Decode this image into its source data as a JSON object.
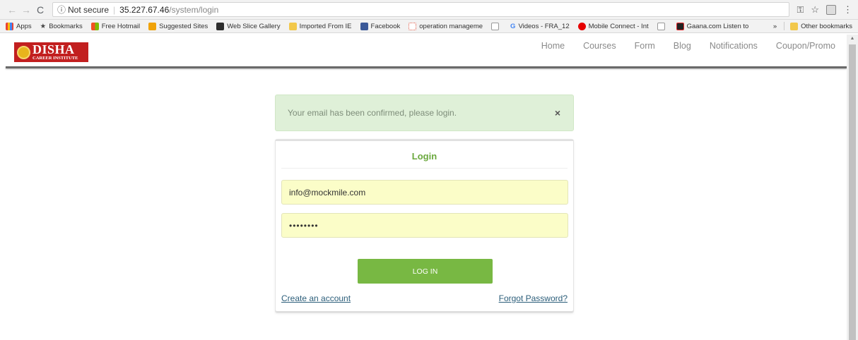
{
  "browser": {
    "security_label": "Not secure",
    "url_host": "35.227.67.46",
    "url_path": "/system/login"
  },
  "bookmarks": {
    "items": [
      {
        "label": "Apps",
        "icon": "apps-grid-icon",
        "color": "#3b78e7"
      },
      {
        "label": "Bookmarks",
        "icon": "star-icon",
        "color": "#444444"
      },
      {
        "label": "Free Hotmail",
        "icon": "windows-icon",
        "color": "#f25022"
      },
      {
        "label": "Suggested Sites",
        "icon": "suggested-sites-icon",
        "color": "#f0a30a"
      },
      {
        "label": "Web Slice Gallery",
        "icon": "web-slice-icon",
        "color": "#2d2d2d"
      },
      {
        "label": "Imported From IE",
        "icon": "folder-icon",
        "color": "#f2c84b"
      },
      {
        "label": "Facebook",
        "icon": "facebook-icon",
        "color": "#3b5998"
      },
      {
        "label": "operation manageme",
        "icon": "operation-icon",
        "color": "#e05a47"
      },
      {
        "label": "",
        "icon": "page-icon",
        "color": "#999999"
      },
      {
        "label": "Videos - FRA_12",
        "icon": "google-icon",
        "color": "#4285f4"
      },
      {
        "label": "Mobile Connect - Int",
        "icon": "vodafone-icon",
        "color": "#e60000"
      },
      {
        "label": "",
        "icon": "page-icon",
        "color": "#999999"
      },
      {
        "label": "Gaana.com Listen to",
        "icon": "gaana-icon",
        "color": "#e72c30"
      }
    ],
    "overflow": "»",
    "other": "Other bookmarks"
  },
  "site": {
    "logo_main": "DISHA",
    "logo_sub": "CAREER INSTITUTE",
    "nav": [
      "Home",
      "Courses",
      "Form",
      "Blog",
      "Notifications",
      "Coupon/Promo"
    ]
  },
  "alert": {
    "message": "Your email has been confirmed, please login.",
    "close": "×"
  },
  "login": {
    "title": "Login",
    "email_value": "info@mockmile.com",
    "password_mask": "••••••••",
    "submit_label": "LOG IN",
    "create_account": "Create an account",
    "forgot_password": "Forgot Password?"
  },
  "colors": {
    "brand_red": "#c21f1f",
    "accent_green": "#78b843",
    "title_green": "#6aa83d",
    "alert_bg": "#dff0d8",
    "field_bg": "#fbfdc8"
  }
}
